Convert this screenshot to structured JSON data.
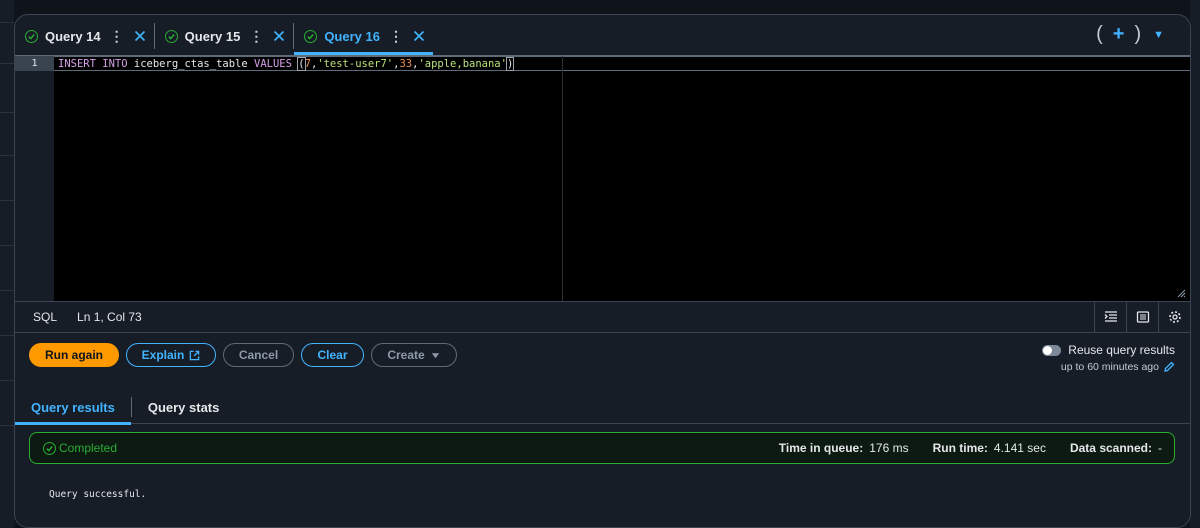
{
  "tabs": [
    {
      "label": "Query 14",
      "active": false
    },
    {
      "label": "Query 15",
      "active": false
    },
    {
      "label": "Query 16",
      "active": true
    }
  ],
  "tab_tools": {
    "open_paren": "(",
    "plus": "+",
    "close_paren": ")",
    "caret": "▼"
  },
  "editor": {
    "line_number": "1",
    "tokens": {
      "kw_insert": "INSERT",
      "kw_into": "INTO",
      "table": "iceberg_ctas_table",
      "kw_values": "VALUES",
      "open": "(",
      "n1": "7",
      "c1": ",",
      "s1": "'test-user7'",
      "c2": ",",
      "n2": "33",
      "c3": ",",
      "s2": "'apple,banana'",
      "close": ")"
    }
  },
  "status": {
    "language": "SQL",
    "position": "Ln 1, Col 73"
  },
  "actions": {
    "run_again": "Run again",
    "explain": "Explain",
    "cancel": "Cancel",
    "clear": "Clear",
    "create": "Create"
  },
  "reuse": {
    "label": "Reuse query results",
    "sub": "up to 60 minutes ago"
  },
  "result_tabs": {
    "results": "Query results",
    "stats": "Query stats"
  },
  "banner": {
    "status": "Completed",
    "time_in_queue_label": "Time in queue:",
    "time_in_queue": "176 ms",
    "run_time_label": "Run time:",
    "run_time": "4.141 sec",
    "data_scanned_label": "Data scanned:",
    "data_scanned": "-"
  },
  "result_message": "Query successful.",
  "colors": {
    "accent": "#42b4ff",
    "primary": "#ff9900",
    "success": "#29ad32"
  }
}
